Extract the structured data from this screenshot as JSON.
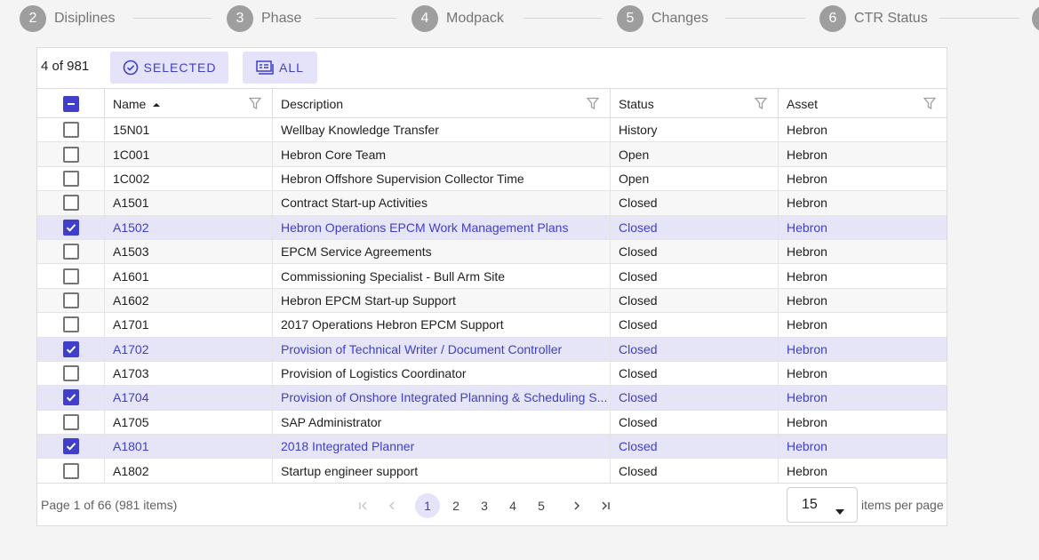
{
  "stepper": {
    "steps": [
      {
        "num": "2",
        "label": "Disiplines"
      },
      {
        "num": "3",
        "label": "Phase"
      },
      {
        "num": "4",
        "label": "Modpack"
      },
      {
        "num": "5",
        "label": "Changes"
      },
      {
        "num": "6",
        "label": "CTR Status"
      }
    ]
  },
  "toolbar": {
    "count": "4 of 981",
    "selected_label": "SELECTED",
    "all_label": "ALL"
  },
  "columns": {
    "name": "Name",
    "description": "Description",
    "status": "Status",
    "asset": "Asset"
  },
  "rows": [
    {
      "checked": false,
      "name": "15N01",
      "description": "Wellbay Knowledge Transfer",
      "status": "History",
      "asset": "Hebron"
    },
    {
      "checked": false,
      "name": "1C001",
      "description": "Hebron Core Team",
      "status": "Open",
      "asset": "Hebron"
    },
    {
      "checked": false,
      "name": "1C002",
      "description": "Hebron Offshore Supervision Collector Time",
      "status": "Open",
      "asset": "Hebron"
    },
    {
      "checked": false,
      "name": "A1501",
      "description": "Contract Start-up Activities",
      "status": "Closed",
      "asset": "Hebron"
    },
    {
      "checked": true,
      "name": "A1502",
      "description": "Hebron Operations EPCM Work Management Plans",
      "status": "Closed",
      "asset": "Hebron"
    },
    {
      "checked": false,
      "name": "A1503",
      "description": "EPCM Service Agreements",
      "status": "Closed",
      "asset": "Hebron"
    },
    {
      "checked": false,
      "name": "A1601",
      "description": "Commissioning Specialist - Bull Arm Site",
      "status": "Closed",
      "asset": "Hebron"
    },
    {
      "checked": false,
      "name": "A1602",
      "description": "Hebron EPCM Start-up Support",
      "status": "Closed",
      "asset": "Hebron"
    },
    {
      "checked": false,
      "name": "A1701",
      "description": "2017 Operations Hebron EPCM Support",
      "status": "Closed",
      "asset": "Hebron"
    },
    {
      "checked": true,
      "name": "A1702",
      "description": "Provision of Technical Writer / Document Controller",
      "status": "Closed",
      "asset": "Hebron"
    },
    {
      "checked": false,
      "name": "A1703",
      "description": "Provision of Logistics Coordinator",
      "status": "Closed",
      "asset": "Hebron"
    },
    {
      "checked": true,
      "name": "A1704",
      "description": "Provision of Onshore Integrated Planning & Scheduling S...",
      "status": "Closed",
      "asset": "Hebron"
    },
    {
      "checked": false,
      "name": "A1705",
      "description": "SAP Administrator",
      "status": "Closed",
      "asset": "Hebron"
    },
    {
      "checked": true,
      "name": "A1801",
      "description": "2018 Integrated Planner",
      "status": "Closed",
      "asset": "Hebron"
    },
    {
      "checked": false,
      "name": "A1802",
      "description": "Startup engineer support",
      "status": "Closed",
      "asset": "Hebron"
    }
  ],
  "pager": {
    "info": "Page 1 of 66 (981 items)",
    "pages": [
      "1",
      "2",
      "3",
      "4",
      "5"
    ],
    "current_page": "1",
    "page_size": "15",
    "page_size_label": "items per page"
  },
  "colors": {
    "accent": "#3f3fc9",
    "accent_bg": "#e5e3f9",
    "selected_row_bg": "#e6e5f7",
    "step_circle": "#9e9e9e"
  }
}
